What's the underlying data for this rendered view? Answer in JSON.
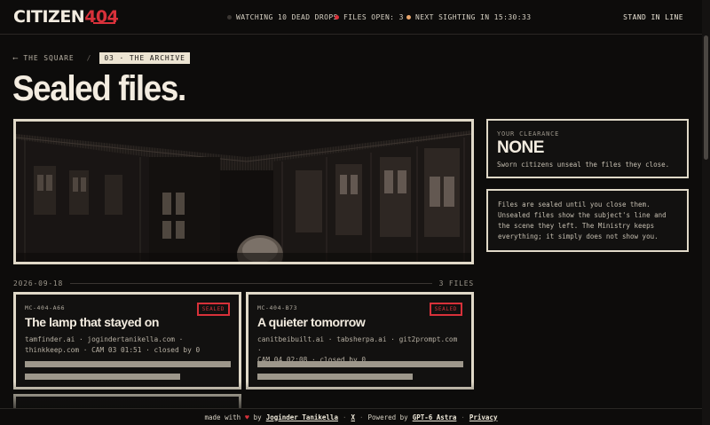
{
  "brand": {
    "name_prefix": "CITIZEN",
    "name_number": "404"
  },
  "status": {
    "watching": {
      "text": "WATCHING 10 DEAD DROPS",
      "color": "#3a3632"
    },
    "files_open": {
      "text": "FILES OPEN: 3",
      "color": "#d8313a"
    },
    "next_sighting": {
      "text": "NEXT SIGHTING IN 15:30:33",
      "color": "#e9a56b"
    }
  },
  "nav": {
    "stand_in_line": "STAND IN LINE"
  },
  "breadcrumb": {
    "back": "⟵  THE SQUARE",
    "separator": "/",
    "current": "03 · THE ARCHIVE"
  },
  "page": {
    "title": "Sealed files."
  },
  "clearance": {
    "label": "YOUR CLEARANCE",
    "value": "NONE",
    "note": "Sworn citizens unseal the files they close."
  },
  "info": {
    "text": "Files are sealed until you close them. Unsealed files show the subject's line and the scene they left. The Ministry keeps everything; it simply does not show you."
  },
  "group": {
    "date": "2026-09-18",
    "count": "3 FILES"
  },
  "files": [
    {
      "id": "MC-404-A66",
      "title": "The lamp that stayed on",
      "badge": "SEALED",
      "meta_line1": "tamfinder.ai · jogindertanikella.com ·",
      "meta_line2": "thinkkeep.com · CAM 03 01:51 · closed by 0"
    },
    {
      "id": "MC-404-B73",
      "title": "A quieter tomorrow",
      "badge": "SEALED",
      "meta_line1": "canitbeibuilt.ai · tabsherpa.ai · git2prompt.com ·",
      "meta_line2": "CAM 04 02:08 · closed by 0"
    }
  ],
  "footer": {
    "made_with": "made with",
    "by": "by",
    "author": "Joginder Tanikella",
    "x_link": "X",
    "powered_by": "Powered by",
    "engine": "GPT-6 Astra",
    "privacy": "Privacy"
  },
  "colors": {
    "accent": "#d8313a",
    "paper": "#e0d9c8",
    "background": "#0d0c0b"
  },
  "icons": {
    "back_arrow": "arrow-left-icon",
    "heart": "heart-icon"
  }
}
